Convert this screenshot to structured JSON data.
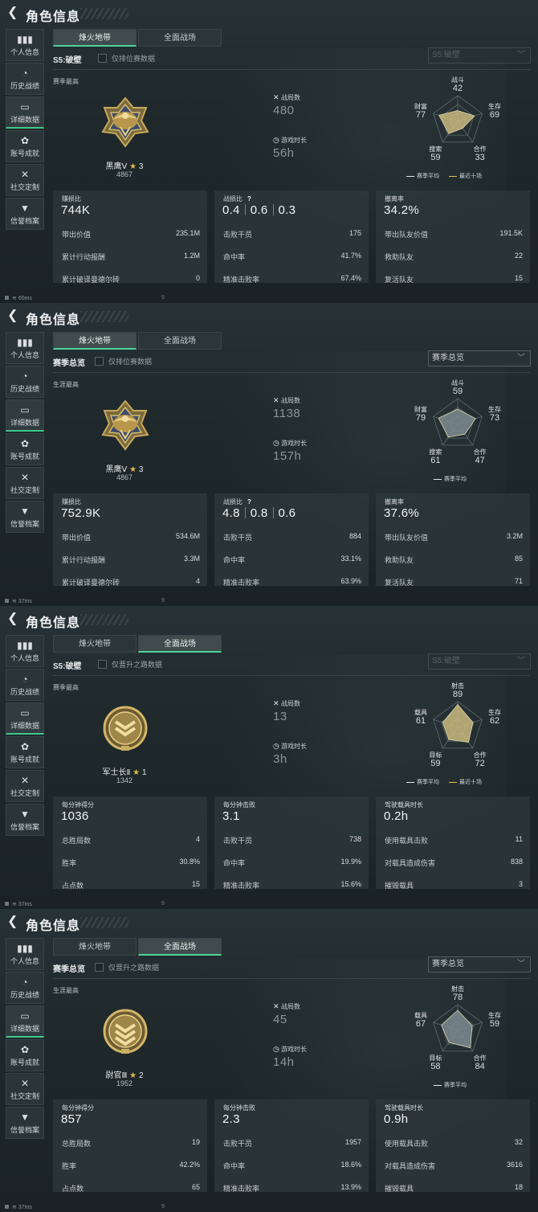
{
  "panels": [
    {
      "title": "角色信息",
      "sidebar": [
        "个人信息",
        "历史战绩",
        "详细数据",
        "账号成就",
        "社交定制",
        "信誉档案"
      ],
      "active_sidebar": 2,
      "tabs": [
        "烽火地带",
        "全面战场"
      ],
      "active_tab": 0,
      "season_label": "S5:破壁",
      "filter_label": "仅排位赛数据",
      "dropdown": "S5:破壁",
      "dropdown_dim": true,
      "best_label": "赛季最高",
      "rank": {
        "name": "黑鹰Ⅴ",
        "stars": "3",
        "score": "4867",
        "medal": "eagle"
      },
      "stats": [
        {
          "icon": "crossed-swords-icon",
          "label": "战局数",
          "value": "480"
        },
        {
          "icon": "stopwatch-icon",
          "label": "游戏时长",
          "value": "56h"
        }
      ],
      "radar": {
        "axes": [
          "战斗",
          "生存",
          "合作",
          "搜索",
          "财富"
        ],
        "values": [
          42,
          69,
          33,
          59,
          77
        ],
        "two_series": true,
        "shape_color": "#c9ba7e"
      },
      "legend": [
        "赛季平均",
        "最近十场"
      ],
      "cards": [
        {
          "title": "赚损比",
          "big": [
            "744K"
          ],
          "rows": [
            [
              "带出价值",
              "235.1M"
            ],
            [
              "累计行动报酬",
              "1.2M"
            ],
            [
              "累计破译曼德尔砖",
              "0"
            ]
          ]
        },
        {
          "title": "战损比",
          "help": "?",
          "big": [
            "0.4",
            "0.6",
            "0.3"
          ],
          "rows": [
            [
              "击败干员",
              "175"
            ],
            [
              "命中率",
              "41.7%"
            ],
            [
              "精准击败率",
              "67.4%"
            ]
          ]
        },
        {
          "title": "撤离率",
          "big": [
            "34.2%"
          ],
          "rows": [
            [
              "带出队友价值",
              "191.5K"
            ],
            [
              "救助队友",
              "22"
            ],
            [
              "复活队友",
              "15"
            ]
          ]
        }
      ],
      "status": {
        "ping": "60ms",
        "num": "9"
      }
    },
    {
      "title": "角色信息",
      "sidebar": [
        "个人信息",
        "历史战绩",
        "详细数据",
        "账号成就",
        "社交定制",
        "信誉档案"
      ],
      "active_sidebar": 2,
      "tabs": [
        "烽火地带",
        "全面战场"
      ],
      "active_tab": 0,
      "season_label": "赛季总览",
      "filter_label": "仅排位赛数据",
      "dropdown": "赛季总览",
      "dropdown_dim": false,
      "best_label": "生涯最高",
      "rank": {
        "name": "黑鹰Ⅴ",
        "stars": "3",
        "score": "4867",
        "medal": "eagle"
      },
      "stats": [
        {
          "icon": "crossed-swords-icon",
          "label": "战局数",
          "value": "1138"
        },
        {
          "icon": "stopwatch-icon",
          "label": "游戏时长",
          "value": "157h"
        }
      ],
      "radar": {
        "axes": [
          "战斗",
          "生存",
          "合作",
          "搜索",
          "财富"
        ],
        "values": [
          59,
          73,
          47,
          61,
          79
        ],
        "two_series": false,
        "shape_color": "#7d8b90"
      },
      "legend": [
        "赛季平均"
      ],
      "cards": [
        {
          "title": "赚损比",
          "big": [
            "752.9K"
          ],
          "rows": [
            [
              "带出价值",
              "534.6M"
            ],
            [
              "累计行动报酬",
              "3.3M"
            ],
            [
              "累计破译曼德尔砖",
              "4"
            ]
          ]
        },
        {
          "title": "战损比",
          "help": "?",
          "big": [
            "4.8",
            "0.8",
            "0.6"
          ],
          "rows": [
            [
              "击败干员",
              "884"
            ],
            [
              "命中率",
              "33.1%"
            ],
            [
              "精准击败率",
              "63.9%"
            ]
          ]
        },
        {
          "title": "撤离率",
          "big": [
            "37.6%"
          ],
          "rows": [
            [
              "带出队友价值",
              "3.2M"
            ],
            [
              "救助队友",
              "85"
            ],
            [
              "复活队友",
              "71"
            ]
          ]
        }
      ],
      "status": {
        "ping": "37ms",
        "num": "9"
      }
    },
    {
      "title": "角色信息",
      "sidebar": [
        "个人信息",
        "历史战绩",
        "详细数据",
        "账号成就",
        "社交定制",
        "信誉档案"
      ],
      "active_sidebar": 2,
      "tabs": [
        "烽火地带",
        "全面战场"
      ],
      "active_tab": 1,
      "season_label": "S5:破壁",
      "filter_label": "仅晋升之路数据",
      "dropdown": "S5:破壁",
      "dropdown_dim": true,
      "best_label": "赛季最高",
      "rank": {
        "name": "军士长Ⅱ",
        "stars": "1",
        "score": "1342",
        "medal": "chevron2"
      },
      "stats": [
        {
          "icon": "crossed-swords-icon",
          "label": "战局数",
          "value": "13"
        },
        {
          "icon": "stopwatch-icon",
          "label": "游戏时长",
          "value": "3h"
        }
      ],
      "radar": {
        "axes": [
          "射击",
          "生存",
          "合作",
          "目标",
          "载具"
        ],
        "values": [
          89,
          62,
          72,
          59,
          61
        ],
        "two_series": true,
        "shape_color": "#c9ba7e"
      },
      "legend": [
        "赛季平均",
        "最近十场"
      ],
      "cards": [
        {
          "title": "每分钟得分",
          "big": [
            "1036"
          ],
          "rows": [
            [
              "总胜局数",
              "4"
            ],
            [
              "胜率",
              "30.8%"
            ],
            [
              "占点数",
              "15"
            ]
          ]
        },
        {
          "title": "每分钟击败",
          "big": [
            "3.1"
          ],
          "rows": [
            [
              "击败干员",
              "738"
            ],
            [
              "命中率",
              "19.9%"
            ],
            [
              "精准击败率",
              "15.6%"
            ]
          ]
        },
        {
          "title": "驾驶载具时长",
          "big": [
            "0.2h"
          ],
          "rows": [
            [
              "使用载具击败",
              "11"
            ],
            [
              "对载具造成伤害",
              "838"
            ],
            [
              "摧毁载具",
              "3"
            ]
          ]
        }
      ],
      "status": {
        "ping": "37ms",
        "num": "9"
      }
    },
    {
      "title": "角色信息",
      "sidebar": [
        "个人信息",
        "历史战绩",
        "详细数据",
        "账号成就",
        "社交定制",
        "信誉档案"
      ],
      "active_sidebar": 2,
      "tabs": [
        "烽火地带",
        "全面战场"
      ],
      "active_tab": 1,
      "season_label": "赛季总览",
      "filter_label": "仅晋升之路数据",
      "dropdown": "赛季总览",
      "dropdown_dim": false,
      "best_label": "生涯最高",
      "rank": {
        "name": "尉官Ⅲ",
        "stars": "2",
        "score": "1952",
        "medal": "chevron3"
      },
      "stats": [
        {
          "icon": "crossed-swords-icon",
          "label": "战局数",
          "value": "45"
        },
        {
          "icon": "stopwatch-icon",
          "label": "游戏时长",
          "value": "14h"
        }
      ],
      "radar": {
        "axes": [
          "射击",
          "生存",
          "合作",
          "目标",
          "载具"
        ],
        "values": [
          78,
          59,
          84,
          58,
          67
        ],
        "two_series": false,
        "shape_color": "#7d8b90"
      },
      "legend": [
        "赛季平均"
      ],
      "cards": [
        {
          "title": "每分钟得分",
          "big": [
            "857"
          ],
          "rows": [
            [
              "总胜局数",
              "19"
            ],
            [
              "胜率",
              "42.2%"
            ],
            [
              "占点数",
              "65"
            ]
          ]
        },
        {
          "title": "每分钟击败",
          "big": [
            "2.3"
          ],
          "rows": [
            [
              "击败干员",
              "1957"
            ],
            [
              "命中率",
              "18.6%"
            ],
            [
              "精准击败率",
              "13.9%"
            ]
          ]
        },
        {
          "title": "驾驶载具时长",
          "big": [
            "0.9h"
          ],
          "rows": [
            [
              "使用载具击败",
              "32"
            ],
            [
              "对载具造成伤害",
              "3616"
            ],
            [
              "摧毁载具",
              "18"
            ]
          ]
        }
      ],
      "status": {
        "ping": "37ms",
        "num": "9"
      }
    }
  ]
}
